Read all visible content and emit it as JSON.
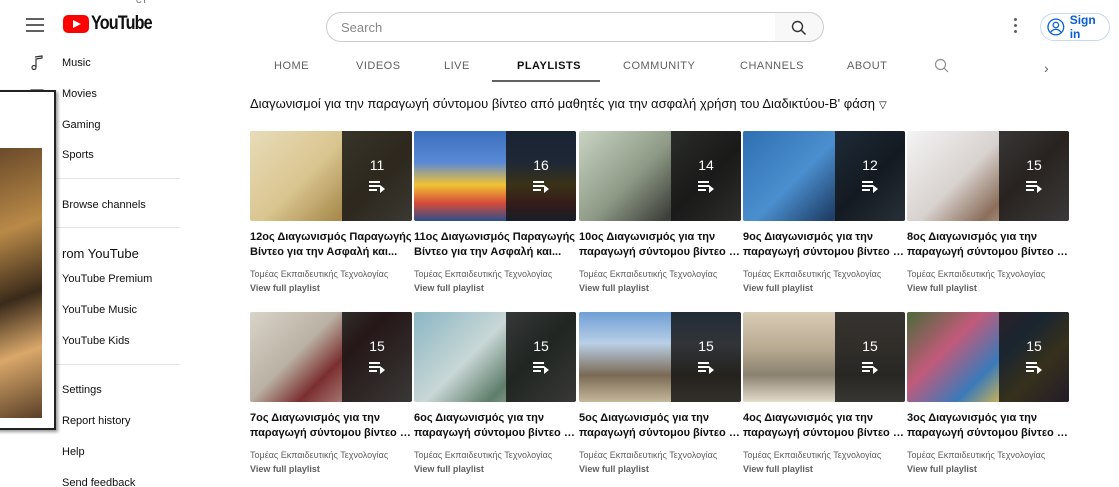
{
  "header": {
    "logo_text": "YouTube",
    "country_code": "CY",
    "search_placeholder": "Search",
    "signin_label": "Sign in"
  },
  "guide": {
    "items": [
      {
        "label": "Music",
        "icon": "music-note-icon"
      },
      {
        "label": "Movies",
        "icon": "film-icon"
      },
      {
        "label": "Gaming",
        "icon": "gaming-icon"
      },
      {
        "label": "Sports",
        "icon": "trophy-icon"
      },
      {
        "label": "Browse channels",
        "icon": "browse-channels-icon"
      }
    ],
    "more_heading": "rom YouTube",
    "more_items": [
      {
        "label": "YouTube Premium"
      },
      {
        "label": "YouTube Music"
      },
      {
        "label": "YouTube Kids"
      }
    ],
    "footer_items": [
      {
        "label": "Settings"
      },
      {
        "label": "Report history"
      },
      {
        "label": "Help"
      },
      {
        "label": "Send feedback"
      }
    ]
  },
  "tabs": [
    {
      "label": "HOME"
    },
    {
      "label": "VIDEOS"
    },
    {
      "label": "LIVE"
    },
    {
      "label": "PLAYLISTS"
    },
    {
      "label": "COMMUNITY"
    },
    {
      "label": "CHANNELS"
    },
    {
      "label": "ABOUT"
    }
  ],
  "section": {
    "title": "Διαγωνισμοί για την παραγωγή σύντομου βίντεο από μαθητές για την ασφαλή χρήση του Διαδικτύου-Β' φάση"
  },
  "playlists": [
    {
      "count": "11",
      "line1": "12ος Διαγωνισμός Παραγωγής",
      "line2": "Βίντεο για την Ασφαλή και...",
      "channel": "Τομέας Εκπαιδευτικής Τεχνολογίας",
      "link": "View full playlist",
      "art": "drawing"
    },
    {
      "count": "16",
      "line1": "11ος Διαγωνισμός Παραγωγής",
      "line2": "Βίντεο για την Ασφαλή και...",
      "channel": "Τομέας Εκπαιδευτικής Τεχνολογίας",
      "link": "View full playlist",
      "art": "poster"
    },
    {
      "count": "14",
      "line1": "10ος Διαγωνισμός για την",
      "line2": "παραγωγή σύντομου βίντεο απ...",
      "channel": "Τομέας Εκπαιδευτικής Τεχνολογίας",
      "link": "View full playlist",
      "art": "classroom"
    },
    {
      "count": "12",
      "line1": "9ος Διαγωνισμός για την",
      "line2": "παραγωγή σύντομου βίντεο απ...",
      "channel": "Τομέας Εκπαιδευτικής Τεχνολογίας",
      "link": "View full playlist",
      "art": "studio"
    },
    {
      "count": "15",
      "line1": "8ος Διαγωνισμός για την",
      "line2": "παραγωγή σύντομου βίντεο απ...",
      "channel": "Τομέας Εκπαιδευτικής Τεχνολογίας",
      "link": "View full playlist",
      "art": "girls"
    },
    {
      "count": "15",
      "line1": "7ος Διαγωνισμός για την",
      "line2": "παραγωγή σύντομου βίντεο απ...",
      "channel": "Τομέας Εκπαιδευτικής Τεχνολογίας",
      "link": "View full playlist",
      "art": "screen"
    },
    {
      "count": "15",
      "line1": "6ος Διαγωνισμός για την",
      "line2": "παραγωγή σύντομου βίντεο απ...",
      "channel": "Τομέας Εκπαιδευτικής Τεχνολογίας",
      "link": "View full playlist",
      "art": "library"
    },
    {
      "count": "15",
      "line1": "5ος Διαγωνισμός για την",
      "line2": "παραγωγή σύντομου βίντεο απ...",
      "channel": "Τομέας Εκπαιδευτικής Τεχνολογίας",
      "link": "View full playlist",
      "art": "outdoor"
    },
    {
      "count": "15",
      "line1": "4ος Διαγωνισμός για την",
      "line2": "παραγωγή σύντομου βίντεο απ...",
      "channel": "Τομέας Εκπαιδευτικής Τεχνολογίας",
      "link": "View full playlist",
      "art": "yard"
    },
    {
      "count": "15",
      "line1": "3ος Διαγωνισμός για την",
      "line2": "παραγωγή σύντομου βίντεο απ...",
      "channel": "Τομέας Εκπαιδευτικής Τεχνολογίας",
      "link": "View full playlist",
      "art": "mural"
    }
  ]
}
